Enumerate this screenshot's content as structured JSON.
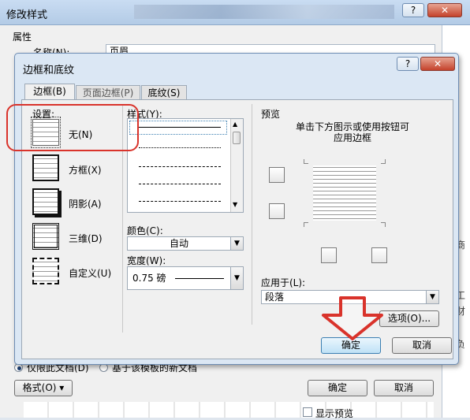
{
  "outer": {
    "title": "修改样式",
    "help": "?",
    "close": "✕",
    "properties_label": "属性",
    "name_label": "名称(N):",
    "name_value": "页眉",
    "add_template_label": "仅限此文档(D)",
    "new_docs_label": "基于该模板的新文档",
    "format_button": "格式(O) ▾",
    "ok": "确定",
    "cancel": "取消",
    "show_preview": "显示预览"
  },
  "inner": {
    "title": "边框和底纹",
    "help": "?",
    "close": "✕",
    "tabs": [
      {
        "label": "边框(B)"
      },
      {
        "label": "页面边框(P)"
      },
      {
        "label": "底纹(S)"
      }
    ],
    "settings_label": "设置:",
    "settings": [
      {
        "label": "无(N)"
      },
      {
        "label": "方框(X)"
      },
      {
        "label": "阴影(A)"
      },
      {
        "label": "三维(D)"
      },
      {
        "label": "自定义(U)"
      }
    ],
    "style_label": "样式(Y):",
    "color_label": "颜色(C):",
    "color_value": "自动",
    "width_label": "宽度(W):",
    "width_value": "0.75 磅",
    "preview_label": "预览",
    "preview_hint_1": "单击下方图示或使用按钮可",
    "preview_hint_2": "应用边框",
    "apply_to_label": "应用于(L):",
    "apply_to_value": "段落",
    "options_button": "选项(O)...",
    "ok": "确定",
    "cancel": "取消"
  },
  "right_panel": {
    "chars": [
      "商",
      "工",
      "财",
      "负"
    ]
  },
  "colors": {
    "highlight_red": "#d9332b",
    "arrow_red": "#d9332b"
  }
}
